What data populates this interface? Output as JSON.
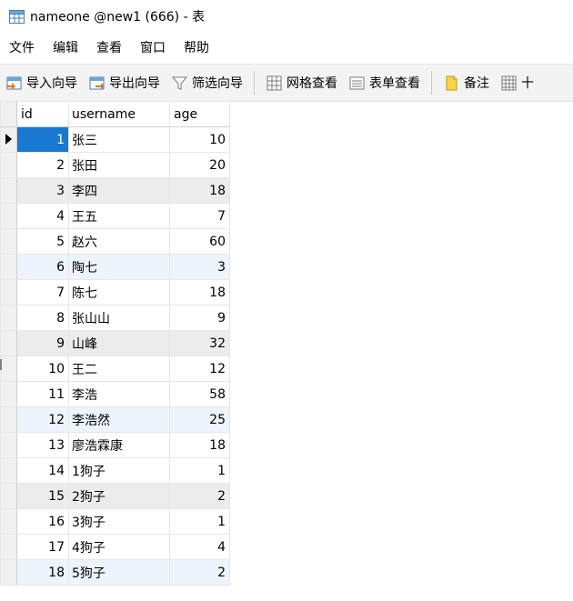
{
  "window": {
    "title": "nameone @new1 (666) - 表"
  },
  "menu": [
    "文件",
    "编辑",
    "查看",
    "窗口",
    "帮助"
  ],
  "toolbar": {
    "import_label": "导入向导",
    "export_label": "导出向导",
    "filter_label": "筛选向导",
    "grid_view_label": "网格查看",
    "form_view_label": "表单查看",
    "memo_label": "备注",
    "hex_label": "十"
  },
  "table": {
    "columns": [
      "id",
      "username",
      "age"
    ],
    "rows": [
      {
        "id": "1",
        "username": "张三",
        "age": "10"
      },
      {
        "id": "2",
        "username": "张田",
        "age": "20"
      },
      {
        "id": "3",
        "username": "李四",
        "age": "18"
      },
      {
        "id": "4",
        "username": "王五",
        "age": "7"
      },
      {
        "id": "5",
        "username": "赵六",
        "age": "60"
      },
      {
        "id": "6",
        "username": "陶七",
        "age": "3"
      },
      {
        "id": "7",
        "username": "陈七",
        "age": "18"
      },
      {
        "id": "8",
        "username": "张山山",
        "age": "9"
      },
      {
        "id": "9",
        "username": "山峰",
        "age": "32"
      },
      {
        "id": "10",
        "username": "王二",
        "age": "12"
      },
      {
        "id": "11",
        "username": "李浩",
        "age": "58"
      },
      {
        "id": "12",
        "username": "李浩然",
        "age": "25"
      },
      {
        "id": "13",
        "username": "廖浩霖康",
        "age": "18"
      },
      {
        "id": "14",
        "username": "1狗子",
        "age": "1"
      },
      {
        "id": "15",
        "username": "2狗子",
        "age": "2"
      },
      {
        "id": "16",
        "username": "3狗子",
        "age": "1"
      },
      {
        "id": "17",
        "username": "4狗子",
        "age": "4"
      },
      {
        "id": "18",
        "username": "5狗子",
        "age": "2"
      }
    ]
  },
  "colors": {
    "selection": "#1878d2",
    "row_alt_blue": "#eef4fb",
    "row_alt_gray": "#ececec"
  }
}
